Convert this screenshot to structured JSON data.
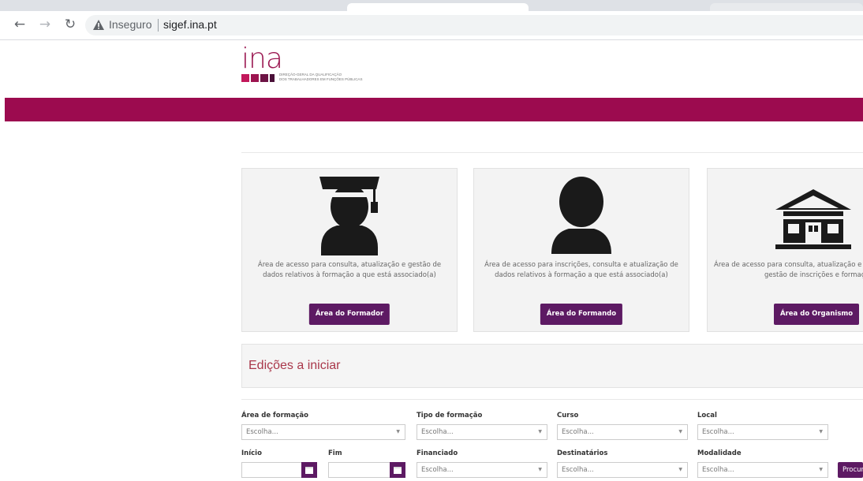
{
  "browser": {
    "security_label": "Inseguro",
    "url": "sigef.ina.pt"
  },
  "header": {
    "logo_text": "ina",
    "logo_tagline_1": "Direção-Geral da Qualificação",
    "logo_tagline_2": "dos Trabalhadores em Funções Públicas",
    "brand_color": "#9c0b4f"
  },
  "cards": [
    {
      "icon": "graduate-icon",
      "description_1": "Área de acesso para consulta, atualização e gestão de",
      "description_2": "dados relativos à formação a que está associado(a)",
      "button_label": "Área do Formador"
    },
    {
      "icon": "user-icon",
      "description_1": "Área de acesso para inscrições, consulta e atualização de",
      "description_2": "dados relativos à formação a que está associado(a)",
      "button_label": "Área do Formando"
    },
    {
      "icon": "building-icon",
      "description_1": "Área de acesso para consulta, atualização e",
      "description_2": "gestão de inscrições e formação",
      "button_label": "Área do Organismo"
    }
  ],
  "editions": {
    "title": "Edições a iniciar"
  },
  "filters": {
    "area_label": "Área de formação",
    "tipo_label": "Tipo de formação",
    "curso_label": "Curso",
    "local_label": "Local",
    "inicio_label": "Início",
    "fim_label": "Fim",
    "financiado_label": "Financiado",
    "destinatarios_label": "Destinatários",
    "modalidade_label": "Modalidade",
    "placeholder": "Escolha...",
    "search_label": "Procurar"
  }
}
